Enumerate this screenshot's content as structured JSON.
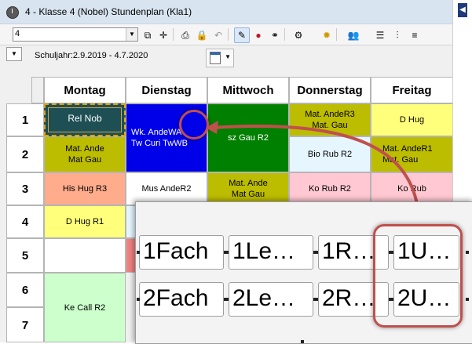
{
  "window": {
    "title": "4 - Klasse 4 (Nobel)  Stundenplan  (Kla1)"
  },
  "toolbar": {
    "combo_value": "4",
    "icons": [
      "nav-first-icon",
      "nav-grid-icon",
      "print-icon",
      "lock-icon",
      "undo-icon",
      "edit-icon",
      "color-icon",
      "connect-icon",
      "settings-icon",
      "gear-icon",
      "users-icon",
      "list-icon",
      "columns-icon"
    ]
  },
  "info": {
    "schuljahr": "Schuljahr:2.9.2019 - 4.7.2020"
  },
  "timetable": {
    "days": [
      "Montag",
      "Dienstag",
      "Mittwoch",
      "Donnerstag",
      "Freitag"
    ],
    "periods": [
      "1",
      "2",
      "3",
      "4",
      "5",
      "6",
      "7"
    ],
    "cells": {
      "mo1": "Rel  Nob",
      "di12_a": "Wk.  AndeWA",
      "di12_b": "Tw  Curi  TwWB",
      "mi12": "sz  Gau  R2",
      "do1": "Mat.  AndeR3",
      "do1b": "Mat.  Gau",
      "fr1": "D    Hug",
      "mo2a": "Mat.  Ande",
      "mo2b": "Mat  Gau",
      "do2": "Bio  Rub  R2",
      "fr2a": "Mat.  AndeR1",
      "fr2b": "Mat.  Gau",
      "mo3": "His  Hug  R3",
      "di3": "Mus  AndeR2",
      "mi3a": "Mat.  Ande",
      "mi3b": "Mat  Gau",
      "do3": "Ko  Rub  R2",
      "fr3": "Ko  Rub",
      "mo4": "D     Hug  R1",
      "mo67": "Ke   Call  R2"
    }
  },
  "overlay": {
    "row1": [
      "1Fach",
      "1Le…",
      "1R…",
      "1U…"
    ],
    "row2": [
      "2Fach",
      "2Le…",
      "2R…",
      "2U…"
    ]
  },
  "colors": {
    "green": "#008000",
    "blue": "#0000e8",
    "olive": "#bcbc00",
    "yellow": "#ffff7c",
    "salmon": "#ffac8c",
    "pink": "#ffc8d2",
    "lightblue": "#e6f6ff",
    "lightgreen": "#ccffcc",
    "highlight": "#c0504d"
  }
}
